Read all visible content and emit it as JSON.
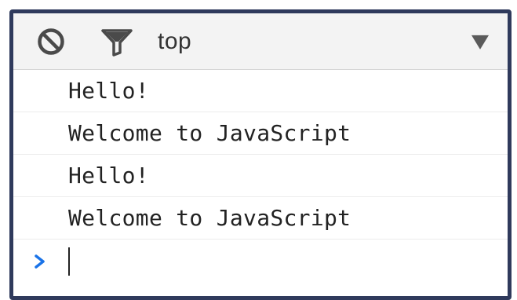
{
  "toolbar": {
    "clear_icon": "clear-console-icon",
    "filter_icon": "filter-icon",
    "context": "top",
    "dropdown_icon": "dropdown-arrow-icon"
  },
  "console": {
    "messages": [
      "Hello!",
      "Welcome to JavaScript",
      "Hello!",
      "Welcome to JavaScript"
    ],
    "prompt_icon": "prompt-chevron-icon",
    "input_value": ""
  },
  "colors": {
    "frame_border": "#2f3a5c",
    "toolbar_bg": "#f3f3f3",
    "prompt_accent": "#1a73e8",
    "text": "#222222"
  }
}
